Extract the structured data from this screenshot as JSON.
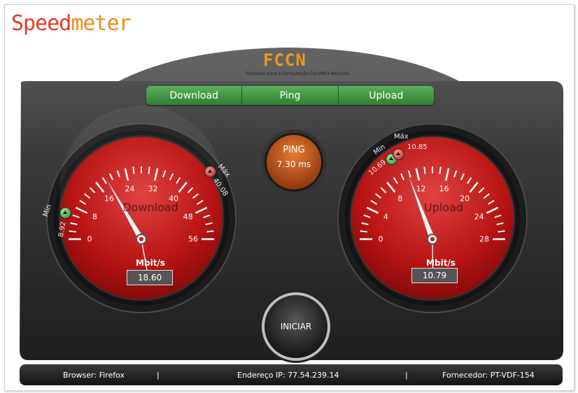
{
  "app": {
    "logo_part1": "Speed",
    "logo_part2": "meter"
  },
  "header": {
    "brand": "FCCN",
    "brand_subtitle": "Fundação para a Computação Científica Nacional"
  },
  "tabs": [
    {
      "label": "Download"
    },
    {
      "label": "Ping"
    },
    {
      "label": "Upload"
    }
  ],
  "ping": {
    "label": "PING",
    "value": "7.30 ms"
  },
  "start_button": {
    "label": "INICIAR"
  },
  "download": {
    "label": "Download",
    "unit": "Mbit/s",
    "value": "18.60",
    "scale": [
      "0",
      "8",
      "16",
      "24",
      "32",
      "40",
      "48",
      "56"
    ],
    "max_scale": 56,
    "needle_value": 18.6,
    "min_label": "Min",
    "min_value": "8.92",
    "max_label": "Máx",
    "max_value": "40.08"
  },
  "upload": {
    "label": "Upload",
    "unit": "Mbit/s",
    "value": "10.79",
    "scale": [
      "0",
      "4",
      "8",
      "12",
      "16",
      "20",
      "24",
      "28"
    ],
    "max_scale": 28,
    "needle_value": 10.79,
    "min_label": "Min",
    "min_value": "10.69",
    "max_label": "Máx",
    "max_value": "10.85"
  },
  "footer": {
    "browser": "Browser: Firefox",
    "separator1": "|",
    "ip": "Endereço IP: 77.54.239.14",
    "separator2": "|",
    "provider": "Fornecedor: PT-VDF-154"
  },
  "colors": {
    "gauge_red": "#c41a1a",
    "tab_green": "#3e8f40",
    "ping_orange": "#c65a1e",
    "logo_red": "#e23a2a",
    "logo_orange": "#f08a1e"
  }
}
